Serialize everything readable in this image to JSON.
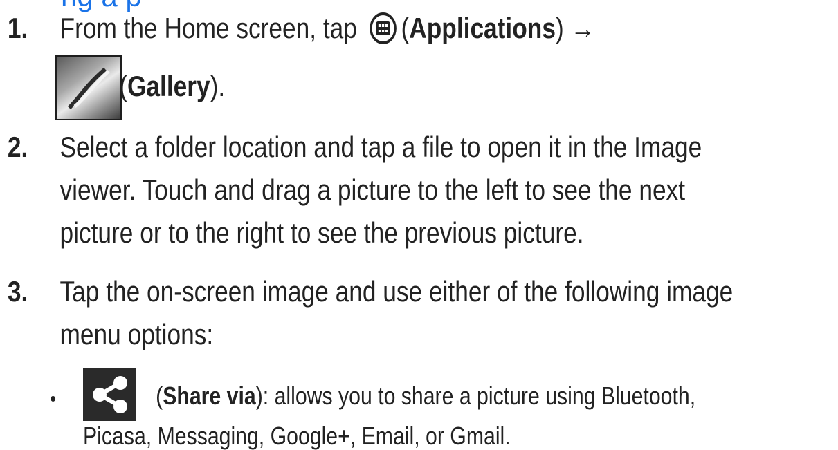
{
  "heading_fragment": "ng a p",
  "steps": [
    {
      "number": "1.",
      "line1_prefix": "From the Home screen, tap",
      "applications_open": "(",
      "applications_label": "Applications",
      "applications_close": ")",
      "arrow": "→",
      "gallery_open": "(",
      "gallery_label": "Gallery",
      "gallery_close": ")."
    },
    {
      "number": "2.",
      "lines": [
        "Select a folder location and tap a file to open it in the Image",
        "viewer. Touch and drag a picture to the left to see the next",
        "picture or to the right to see the previous picture."
      ]
    },
    {
      "number": "3.",
      "lines": [
        "Tap the on-screen image and use either of the following image",
        "menu options:"
      ],
      "bullet": {
        "dot": "•",
        "open": "(",
        "label": "Share via",
        "close": ")",
        "line1_rest": ": allows you to share a picture using Bluetooth,",
        "line2": "Picasa, Messaging, Google+, Email, or Gmail."
      }
    }
  ],
  "icons": {
    "applications": "applications-grid-icon",
    "gallery": "gallery-icon",
    "share": "share-icon"
  },
  "colors": {
    "heading": "#1a73e8",
    "text": "#222222"
  }
}
